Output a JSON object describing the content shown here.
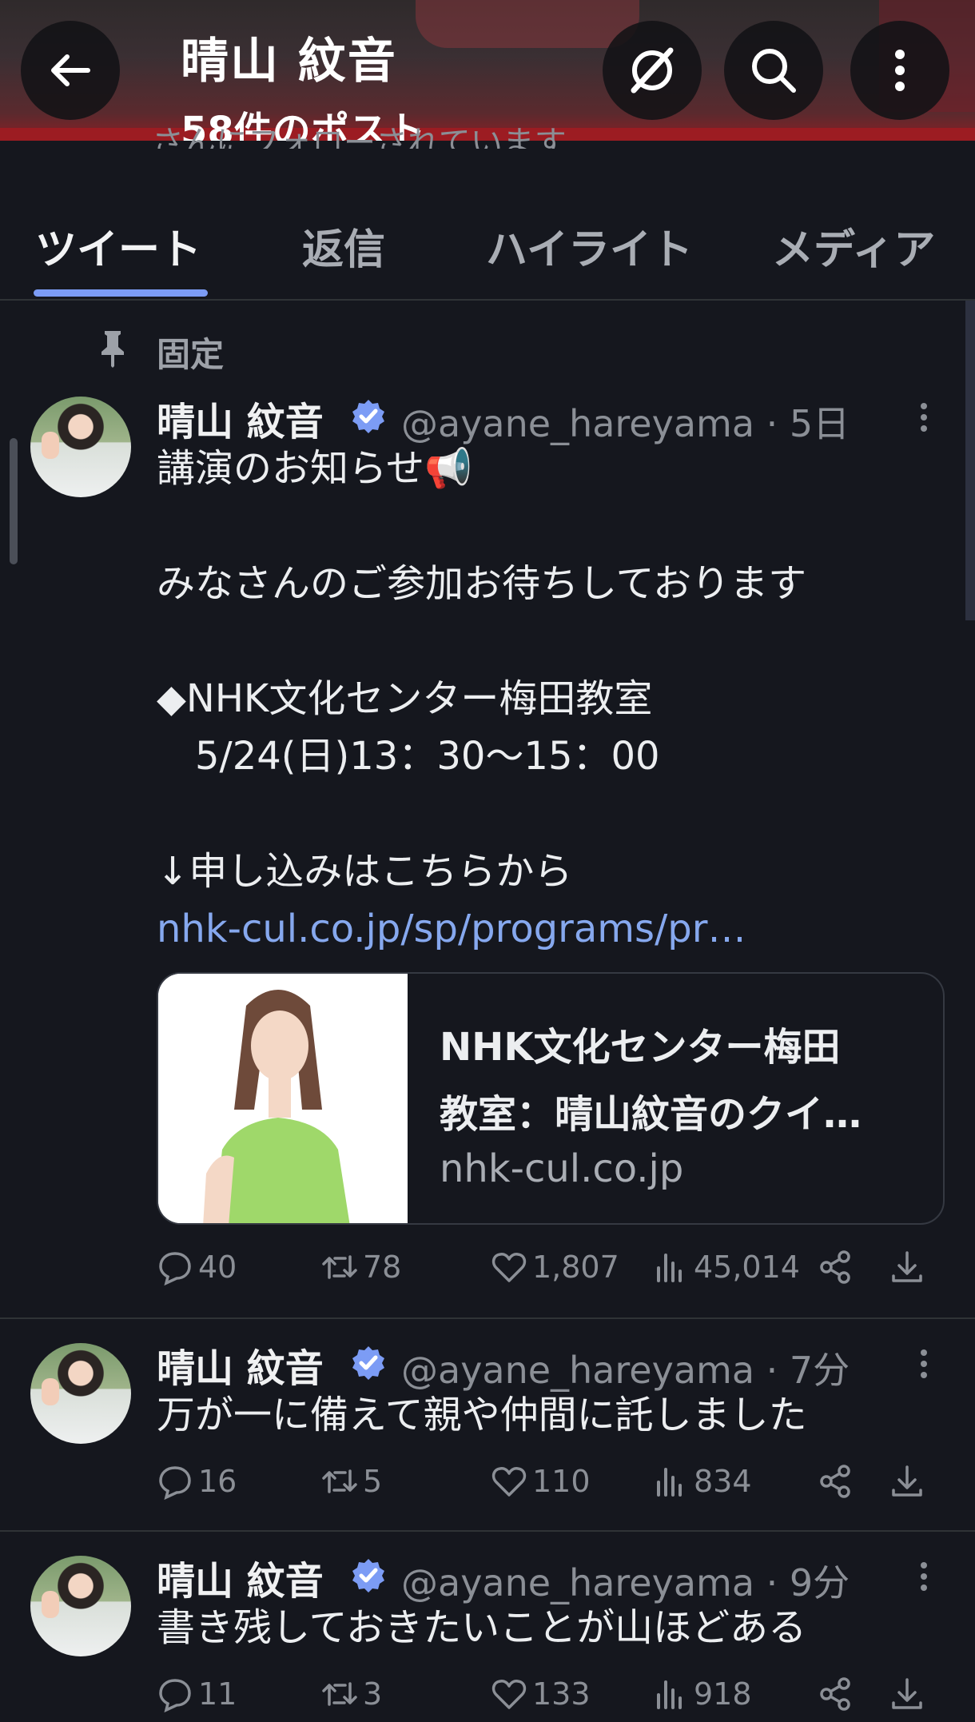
{
  "header": {
    "title": "晴山 紋音",
    "post_count": "58件のポスト",
    "hidden_bio_fragment": "さんにフォローされています"
  },
  "tabs": [
    "ツイート",
    "返信",
    "ハイライト",
    "メディア"
  ],
  "pinned_label": "固定",
  "tweets": [
    {
      "name": "晴山 紋音",
      "handle": "@ayane_hareyama · 5日",
      "lines": [
        "講演のお知らせ📢",
        "",
        "みなさんのご参加お待ちしております",
        "",
        "◆NHK文化センター梅田教室",
        "　5/24(日)13：30〜15：00",
        "",
        "↓申し込みはこちらから"
      ],
      "link": "nhk-cul.co.jp/sp/programs/pr…",
      "card": {
        "title_line1": "NHK文化センター梅田",
        "title_line2": "教室：晴山紋音のクイ…",
        "domain": "nhk-cul.co.jp"
      },
      "stats": {
        "replies": "40",
        "retweets": "78",
        "likes": "1,807",
        "views": "45,014"
      }
    },
    {
      "name": "晴山 紋音",
      "handle": "@ayane_hareyama · 7分",
      "text": "万が一に備えて親や仲間に託しました",
      "stats": {
        "replies": "16",
        "retweets": "5",
        "likes": "110",
        "views": "834"
      }
    },
    {
      "name": "晴山 紋音",
      "handle": "@ayane_hareyama · 9分",
      "text": "書き残しておきたいことが山ほどある",
      "stats": {
        "replies": "11",
        "retweets": "3",
        "likes": "133",
        "views": "918"
      }
    }
  ],
  "colors": {
    "background": "#15171e",
    "accent": "#7c9cf5",
    "link": "#86a8ee",
    "verified": "#7c9cf5",
    "muted": "#8b8f96"
  }
}
